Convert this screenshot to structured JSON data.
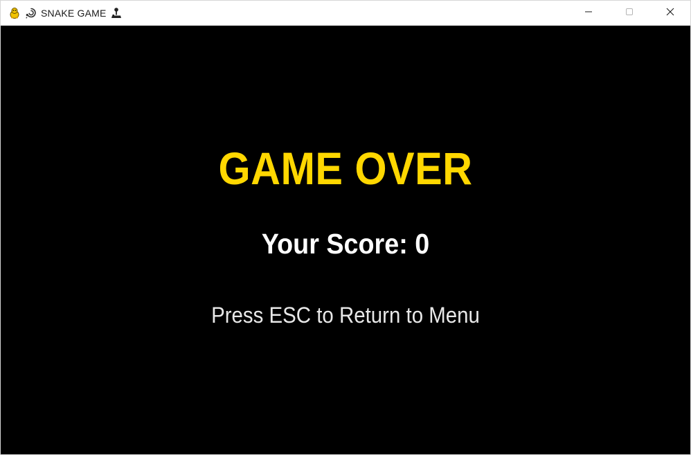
{
  "window": {
    "title": "SNAKE GAME",
    "title_prefix_icon": "snake-emoji-icon",
    "title_suffix_icon": "joystick-emoji-icon",
    "app_icon": "pygame-snake-icon",
    "controls": {
      "minimize_icon": "minimize-icon",
      "maximize_icon": "maximize-icon",
      "close_icon": "close-icon"
    }
  },
  "game_over_screen": {
    "heading": "GAME OVER",
    "score_text": "Your Score: 0",
    "hint_text": "Press ESC to Return to Menu"
  },
  "colors": {
    "background": "#000000",
    "heading": "#ffd700",
    "score": "#ffffff",
    "hint": "#e8e8e8",
    "titlebar": "#ffffff"
  }
}
